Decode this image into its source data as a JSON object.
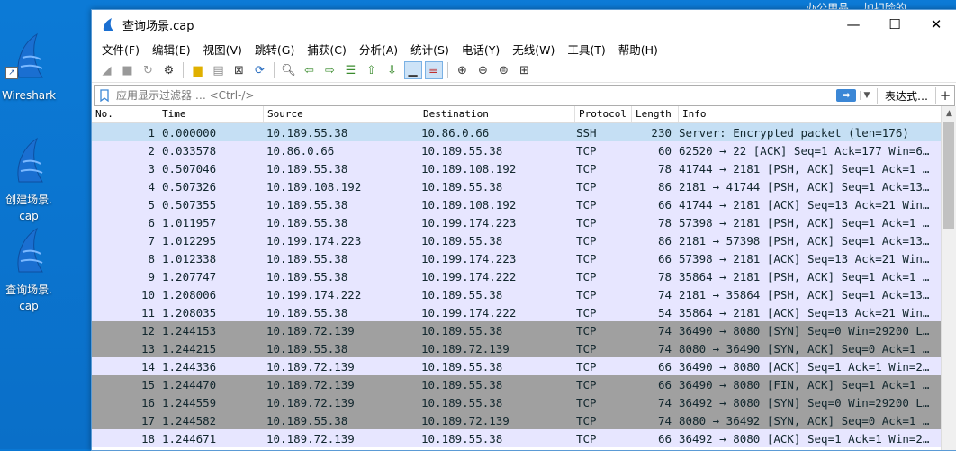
{
  "desktop": {
    "icons": [
      {
        "label": "Wireshark"
      },
      {
        "label": "创建场景.\ncap"
      },
      {
        "label": "查询场景.\ncap"
      }
    ],
    "topright_text": "办公用品…   加扣险的"
  },
  "window": {
    "title": "查询场景.cap",
    "controls": {
      "minimize": "—",
      "maximize": "☐",
      "close": "✕"
    }
  },
  "menu": [
    {
      "label": "文件(F)"
    },
    {
      "label": "编辑(E)"
    },
    {
      "label": "视图(V)"
    },
    {
      "label": "跳转(G)"
    },
    {
      "label": "捕获(C)"
    },
    {
      "label": "分析(A)"
    },
    {
      "label": "统计(S)"
    },
    {
      "label": "电话(Y)"
    },
    {
      "label": "无线(W)"
    },
    {
      "label": "工具(T)"
    },
    {
      "label": "帮助(H)"
    }
  ],
  "filter": {
    "placeholder": "应用显示过滤器 … <Ctrl-/>",
    "expression_label": "表达式…",
    "add_label": "+"
  },
  "columns": [
    "No.",
    "Time",
    "Source",
    "Destination",
    "Protocol",
    "Length",
    "Info"
  ],
  "packets": [
    {
      "no": "1",
      "time": "0.000000",
      "src": "10.189.55.38",
      "dst": "10.86.0.66",
      "proto": "SSH",
      "len": "230",
      "info": "Server: Encrypted packet (len=176)",
      "color": "ssh"
    },
    {
      "no": "2",
      "time": "0.033578",
      "src": "10.86.0.66",
      "dst": "10.189.55.38",
      "proto": "TCP",
      "len": "60",
      "info": "62520 → 22 [ACK] Seq=1 Ack=177 Win=6…",
      "color": "tcp"
    },
    {
      "no": "3",
      "time": "0.507046",
      "src": "10.189.55.38",
      "dst": "10.189.108.192",
      "proto": "TCP",
      "len": "78",
      "info": "41744 → 2181 [PSH, ACK] Seq=1 Ack=1 …",
      "color": "tcp"
    },
    {
      "no": "4",
      "time": "0.507326",
      "src": "10.189.108.192",
      "dst": "10.189.55.38",
      "proto": "TCP",
      "len": "86",
      "info": "2181 → 41744 [PSH, ACK] Seq=1 Ack=13…",
      "color": "tcp"
    },
    {
      "no": "5",
      "time": "0.507355",
      "src": "10.189.55.38",
      "dst": "10.189.108.192",
      "proto": "TCP",
      "len": "66",
      "info": "41744 → 2181 [ACK] Seq=13 Ack=21 Win…",
      "color": "tcp"
    },
    {
      "no": "6",
      "time": "1.011957",
      "src": "10.189.55.38",
      "dst": "10.199.174.223",
      "proto": "TCP",
      "len": "78",
      "info": "57398 → 2181 [PSH, ACK] Seq=1 Ack=1 …",
      "color": "tcp"
    },
    {
      "no": "7",
      "time": "1.012295",
      "src": "10.199.174.223",
      "dst": "10.189.55.38",
      "proto": "TCP",
      "len": "86",
      "info": "2181 → 57398 [PSH, ACK] Seq=1 Ack=13…",
      "color": "tcp"
    },
    {
      "no": "8",
      "time": "1.012338",
      "src": "10.189.55.38",
      "dst": "10.199.174.223",
      "proto": "TCP",
      "len": "66",
      "info": "57398 → 2181 [ACK] Seq=13 Ack=21 Win…",
      "color": "tcp"
    },
    {
      "no": "9",
      "time": "1.207747",
      "src": "10.189.55.38",
      "dst": "10.199.174.222",
      "proto": "TCP",
      "len": "78",
      "info": "35864 → 2181 [PSH, ACK] Seq=1 Ack=1 …",
      "color": "tcp"
    },
    {
      "no": "10",
      "time": "1.208006",
      "src": "10.199.174.222",
      "dst": "10.189.55.38",
      "proto": "TCP",
      "len": "74",
      "info": "2181 → 35864 [PSH, ACK] Seq=1 Ack=13…",
      "color": "tcp"
    },
    {
      "no": "11",
      "time": "1.208035",
      "src": "10.189.55.38",
      "dst": "10.199.174.222",
      "proto": "TCP",
      "len": "54",
      "info": "35864 → 2181 [ACK] Seq=13 Ack=21 Win…",
      "color": "tcp"
    },
    {
      "no": "12",
      "time": "1.244153",
      "src": "10.189.72.139",
      "dst": "10.189.55.38",
      "proto": "TCP",
      "len": "74",
      "info": "36490 → 8080 [SYN] Seq=0 Win=29200 L…",
      "color": "syn"
    },
    {
      "no": "13",
      "time": "1.244215",
      "src": "10.189.55.38",
      "dst": "10.189.72.139",
      "proto": "TCP",
      "len": "74",
      "info": "8080 → 36490 [SYN, ACK] Seq=0 Ack=1 …",
      "color": "syn"
    },
    {
      "no": "14",
      "time": "1.244336",
      "src": "10.189.72.139",
      "dst": "10.189.55.38",
      "proto": "TCP",
      "len": "66",
      "info": "36490 → 8080 [ACK] Seq=1 Ack=1 Win=2…",
      "color": "tcp"
    },
    {
      "no": "15",
      "time": "1.244470",
      "src": "10.189.72.139",
      "dst": "10.189.55.38",
      "proto": "TCP",
      "len": "66",
      "info": "36490 → 8080 [FIN, ACK] Seq=1 Ack=1 …",
      "color": "syn"
    },
    {
      "no": "16",
      "time": "1.244559",
      "src": "10.189.72.139",
      "dst": "10.189.55.38",
      "proto": "TCP",
      "len": "74",
      "info": "36492 → 8080 [SYN] Seq=0 Win=29200 L…",
      "color": "syn"
    },
    {
      "no": "17",
      "time": "1.244582",
      "src": "10.189.55.38",
      "dst": "10.189.72.139",
      "proto": "TCP",
      "len": "74",
      "info": "8080 → 36492 [SYN, ACK] Seq=0 Ack=1 …",
      "color": "syn"
    },
    {
      "no": "18",
      "time": "1.244671",
      "src": "10.189.72.139",
      "dst": "10.189.55.38",
      "proto": "TCP",
      "len": "66",
      "info": "36492 → 8080 [ACK] Seq=1 Ack=1 Win=2…",
      "color": "tcp"
    }
  ]
}
